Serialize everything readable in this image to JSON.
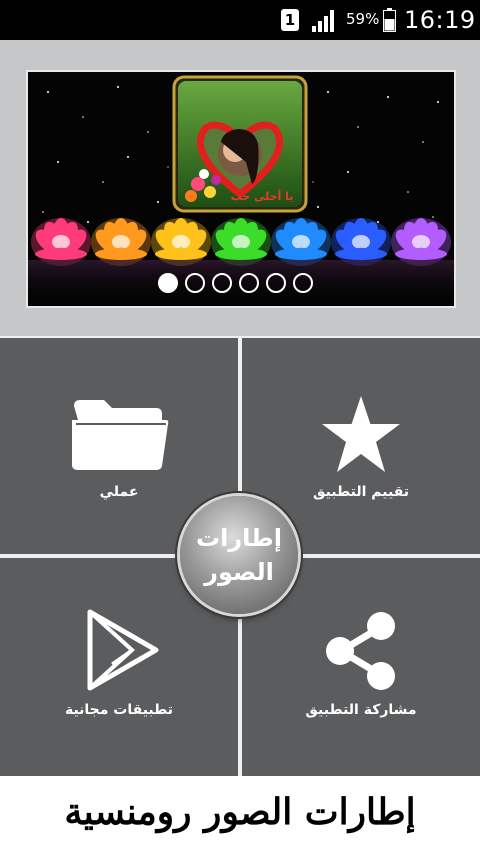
{
  "status_bar": {
    "sim_badge": "1",
    "battery_percent": "59%",
    "clock": "16:19"
  },
  "banner": {
    "frame_caption": "يا أحلى حب",
    "carousel_pages": 6,
    "carousel_active_index": 0,
    "lotus_colors": [
      "#ff3b7a",
      "#ff9a1e",
      "#ffc21a",
      "#3bdc2a",
      "#1f8bff",
      "#2a5cff",
      "#b35cff"
    ]
  },
  "menu": {
    "my_work_label": "عملي",
    "rate_app_label": "تقييم التطبيق",
    "free_apps_label": "تطبيقات مجانية",
    "share_app_label": "مشاركة التطبيق",
    "center_line1": "إطارات",
    "center_line2": "الصور"
  },
  "footer": {
    "title": "إطارات الصور رومنسية"
  }
}
